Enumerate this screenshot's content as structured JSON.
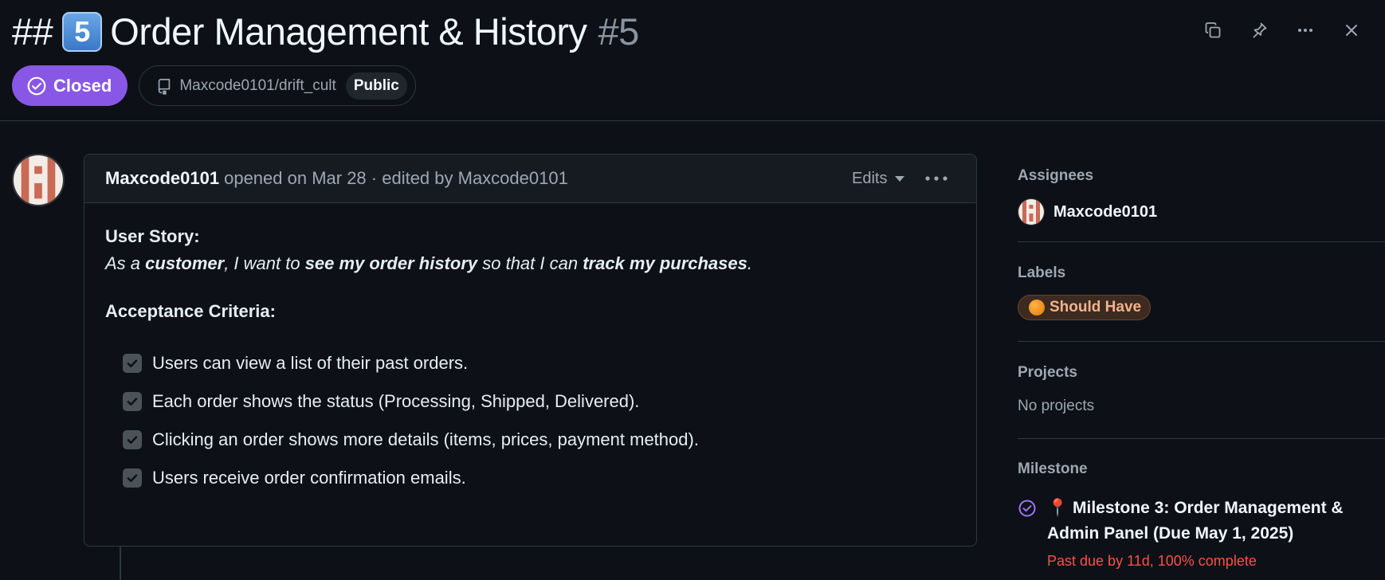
{
  "issue": {
    "title_prefix": "##",
    "title_keycap": "5",
    "title_text": "Order Management & History",
    "number": "#5",
    "state": "Closed",
    "repo": "Maxcode0101/drift_cult",
    "visibility": "Public"
  },
  "header_actions": {
    "icons": [
      "copy-icon",
      "pin-icon",
      "kebab-horizontal-icon",
      "close-icon"
    ]
  },
  "comment": {
    "author": "Maxcode0101",
    "meta": "opened on Mar 28 · edited by Maxcode0101",
    "edits_label": "Edits",
    "story_heading": "User Story:",
    "story": {
      "p1": "As a ",
      "b1": "customer",
      "p2": ", I want to ",
      "b2": "see my order history",
      "p3": " so that I can ",
      "b3": "track my purchases",
      "p4": "."
    },
    "criteria_heading": "Acceptance Criteria:",
    "criteria": [
      {
        "text": "Users can view a list of their past orders.",
        "checked": true
      },
      {
        "text": "Each order shows the status (Processing, Shipped, Delivered).",
        "checked": true
      },
      {
        "text": "Clicking an order shows more details (items, prices, payment method).",
        "checked": true
      },
      {
        "text": "Users receive order confirmation emails.",
        "checked": true
      }
    ]
  },
  "sidebar": {
    "assignees": {
      "heading": "Assignees",
      "name": "Maxcode0101"
    },
    "labels": {
      "heading": "Labels",
      "label": "Should Have",
      "color": "#f0b38d"
    },
    "projects": {
      "heading": "Projects",
      "value": "No projects"
    },
    "milestone": {
      "heading": "Milestone",
      "pin": "📍",
      "title_line1": "Milestone 3: Order Management &",
      "title_line2": "Admin Panel (Due May 1, 2025)",
      "status": "Past due by 11d, 100% complete"
    }
  },
  "colors": {
    "closed_badge": "#8957e5",
    "past_due": "#f85149",
    "background": "#0d1117"
  }
}
